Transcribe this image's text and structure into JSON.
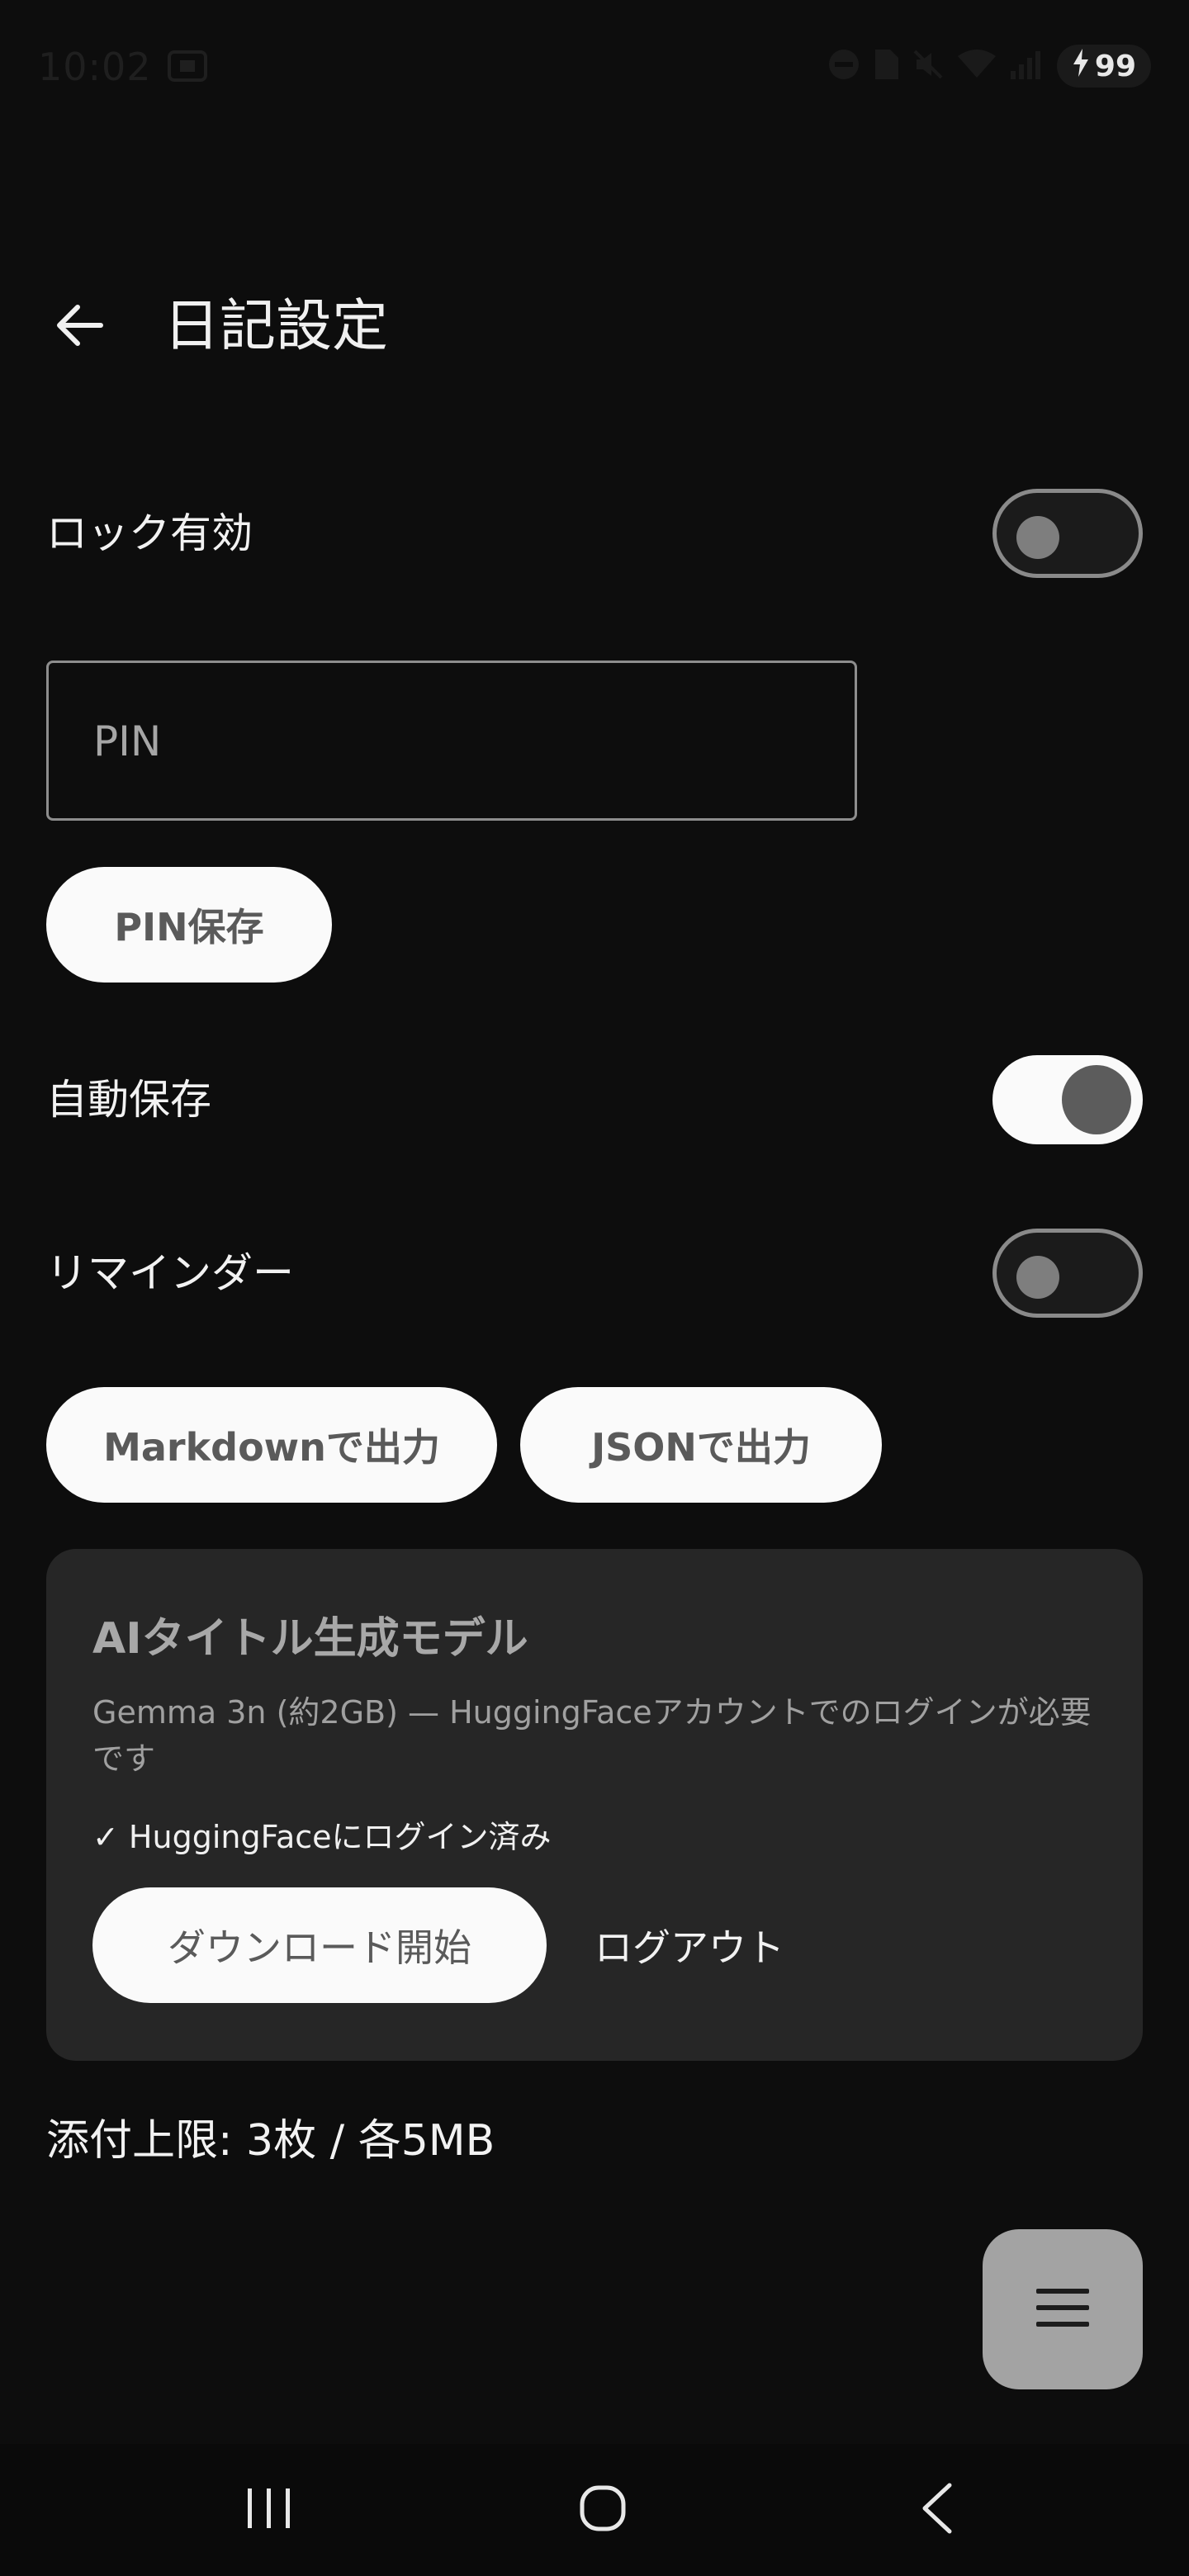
{
  "status_bar": {
    "time": "10:02",
    "battery": "99"
  },
  "header": {
    "title": "日記設定"
  },
  "settings": {
    "lock_label": "ロック有効",
    "lock_enabled": false,
    "pin_placeholder": "PIN",
    "pin_save_label": "PIN保存",
    "autosave_label": "自動保存",
    "autosave_enabled": true,
    "reminder_label": "リマインダー",
    "reminder_enabled": false,
    "export_markdown_label": "Markdownで出力",
    "export_json_label": "JSONで出力"
  },
  "ai_card": {
    "title": "AIタイトル生成モデル",
    "description": "Gemma 3n (約2GB) — HuggingFaceアカウントでのログインが必要です",
    "status": "✓ HuggingFaceにログイン済み",
    "download_label": "ダウンロード開始",
    "logout_label": "ログアウト"
  },
  "attachment_limit": "添付上限: 3枚 / 各5MB",
  "icons": {
    "back": "arrow-left-icon",
    "fab": "menu-icon",
    "nav_recents": "recents-icon",
    "nav_home": "home-icon",
    "nav_back": "back-icon"
  },
  "colors": {
    "background": "#0d0d0d",
    "card": "#262626",
    "pill": "#fafafa",
    "fab": "#a3a3a3"
  }
}
